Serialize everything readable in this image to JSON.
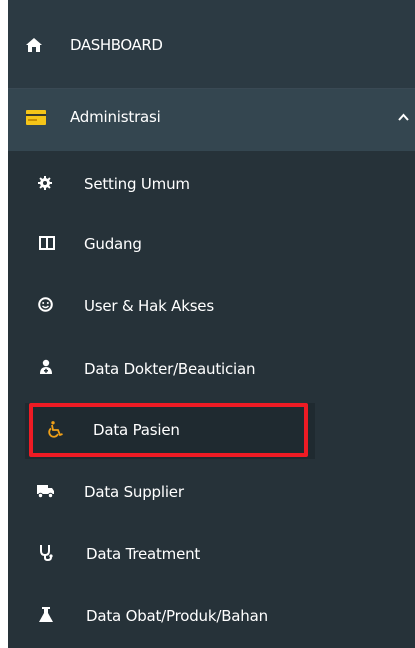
{
  "menu": {
    "dashboard": {
      "label": "DASHBOARD",
      "icon": "home-icon"
    },
    "administrasi": {
      "label": "Administrasi",
      "icon": "card-icon",
      "expanded": true
    },
    "subitems": [
      {
        "label": "Setting Umum",
        "icon": "gear-icon"
      },
      {
        "label": "Gudang",
        "icon": "columns-icon"
      },
      {
        "label": "User & Hak Akses",
        "icon": "smiley-icon"
      },
      {
        "label": "Data Dokter/Beautician",
        "icon": "users-icon"
      },
      {
        "label": "Data Pasien",
        "icon": "wheelchair-icon",
        "active": true
      },
      {
        "label": "Data Supplier",
        "icon": "truck-icon"
      },
      {
        "label": "Data Treatment",
        "icon": "stethoscope-icon"
      },
      {
        "label": "Data Obat/Produk/Bahan",
        "icon": "flask-icon"
      }
    ]
  },
  "colors": {
    "sidebar_bg": "#2d3b44",
    "submenu_bg": "#263239",
    "admin_bg": "#344650",
    "active_icon": "#f0a018",
    "highlight_border": "#ee1b24",
    "card_icon": "#f5c518"
  }
}
